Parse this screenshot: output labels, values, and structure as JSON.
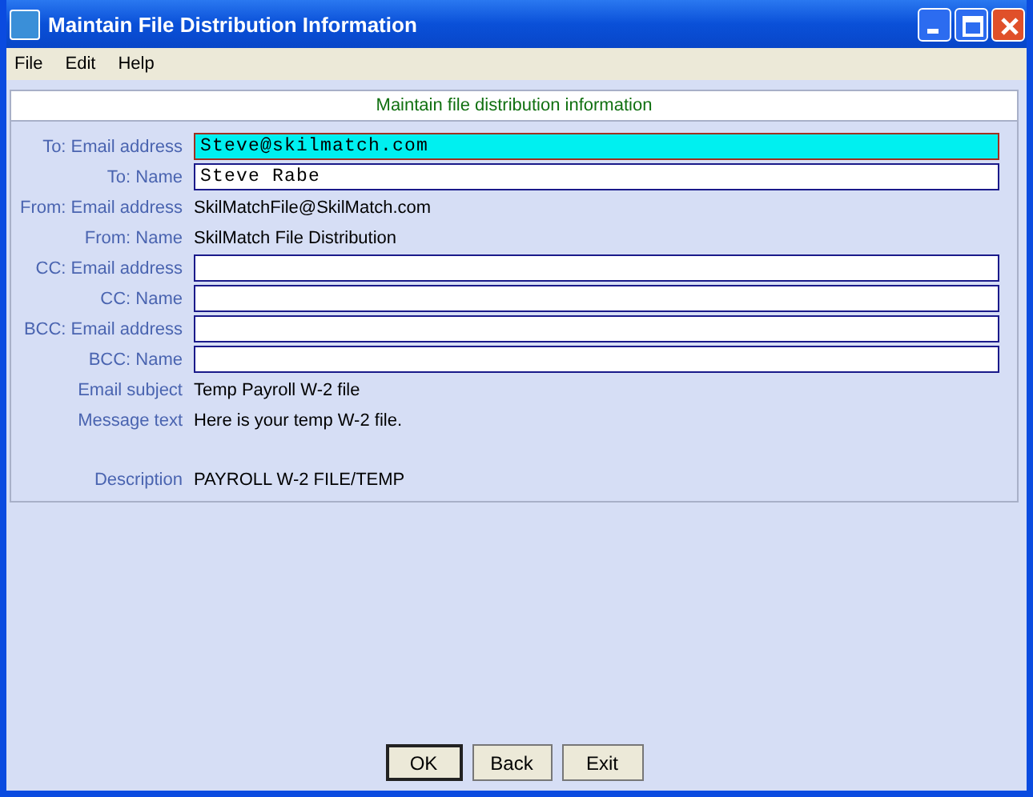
{
  "window": {
    "title": "Maintain File Distribution Information"
  },
  "menu": [
    "File",
    "Edit",
    "Help"
  ],
  "header": "Maintain file distribution information",
  "rows": [
    {
      "label": "To: Email address",
      "kind": "field",
      "value": "Steve@skilmatch.com",
      "focused": true
    },
    {
      "label": "To: Name",
      "kind": "field",
      "value": "Steve Rabe",
      "focused": false
    },
    {
      "label": "From: Email address",
      "kind": "text",
      "value": "SkilMatchFile@SkilMatch.com"
    },
    {
      "label": "From: Name",
      "kind": "text",
      "value": "SkilMatch File Distribution"
    },
    {
      "label": "CC: Email address",
      "kind": "field",
      "focused": false
    },
    {
      "label": "CC: Name",
      "kind": "field",
      "focused": false
    },
    {
      "label": "BCC: Email address",
      "kind": "field",
      "focused": false
    },
    {
      "label": "BCC: Name",
      "kind": "field",
      "focused": false
    },
    {
      "label": "Email subject",
      "kind": "text",
      "value": "Temp Payroll W-2 file"
    },
    {
      "label": "Message text",
      "kind": "text",
      "value": "Here is your temp W-2 file."
    },
    {
      "kind": "spacer"
    },
    {
      "label": "Description",
      "kind": "text",
      "value": "PAYROLL W-2 FILE/TEMP"
    }
  ],
  "buttons": [
    "OK",
    "Back",
    "Exit"
  ]
}
